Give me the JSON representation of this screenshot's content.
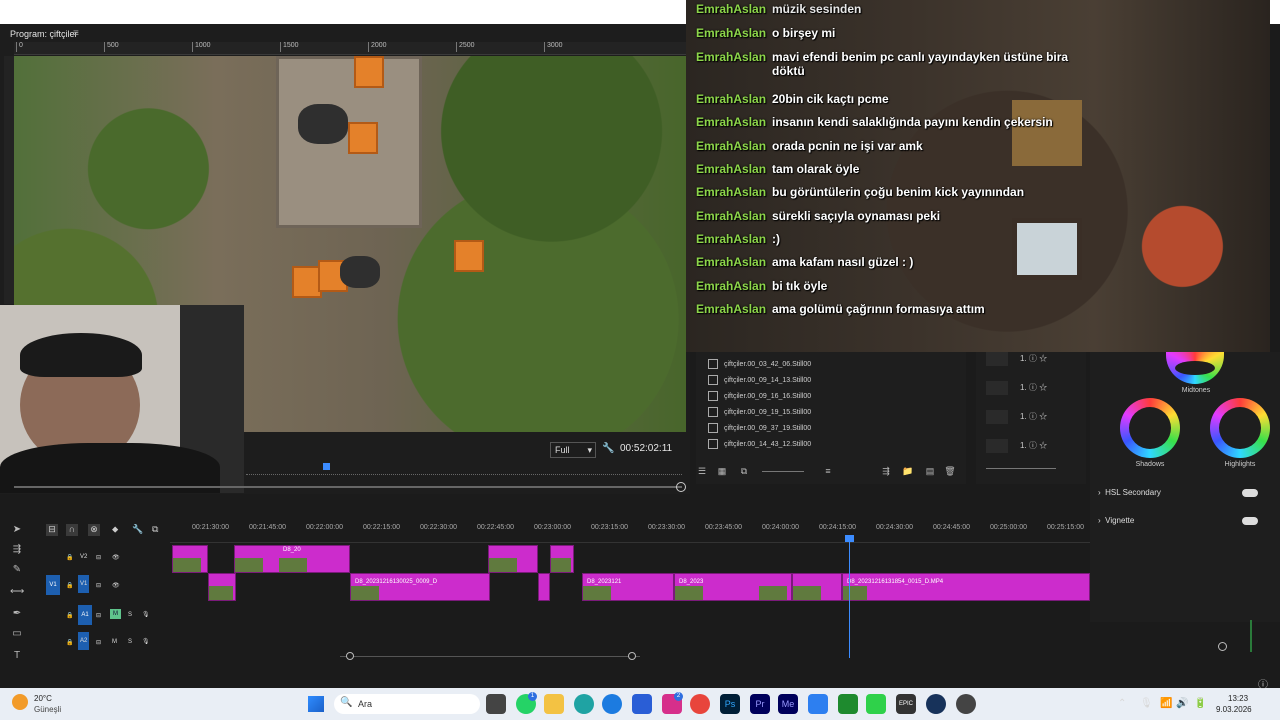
{
  "program_monitor": {
    "title": "Program: çiftçiler",
    "menu_icon": "hamburger-icon",
    "ruler_ticks": [
      "0",
      "500",
      "1000",
      "1500",
      "2000",
      "2500",
      "3000"
    ],
    "zoom_value": "Full",
    "timecode": "00:52:02:11"
  },
  "chat": {
    "header_user": "EmrahAslan",
    "header_msg": "müzik sesinden",
    "messages": [
      {
        "user": "EmrahAslan",
        "text": "o birşey mi"
      },
      {
        "user": "EmrahAslan",
        "text": "mavi efendi benim pc canlı yayındayken üstüne bira döktü"
      },
      {
        "user": "EmrahAslan",
        "text": "20bin cik kaçtı pcme"
      },
      {
        "user": "EmrahAslan",
        "text": "insanın kendi salaklığında payını kendin çekersin"
      },
      {
        "user": "EmrahAslan",
        "text": "orada pcnin ne işi var amk"
      },
      {
        "user": "EmrahAslan",
        "text": "tam olarak öyle"
      },
      {
        "user": "EmrahAslan",
        "text": "bu görüntülerin çoğu benim kick yayınından"
      },
      {
        "user": "EmrahAslan",
        "text": "sürekli saçıyla oynaması peki"
      },
      {
        "user": "EmrahAslan",
        "text": ":)"
      },
      {
        "user": "EmrahAslan",
        "text": "ama kafam nasıl güzel : )"
      },
      {
        "user": "EmrahAslan",
        "text": "bi tık öyle"
      },
      {
        "user": "EmrahAslan",
        "text": "ama golümü çağrının formasıya attım"
      }
    ]
  },
  "project_bin": {
    "items": [
      "çiftçiler.00_03_42_06.Still00",
      "çiftçiler.00_09_14_13.Still00",
      "çiftçiler.00_09_16_16.Still00",
      "çiftçiler.00_09_19_15.Still00",
      "çiftçiler.00_09_37_19.Still00",
      "çiftçiler.00_14_43_12.Still00"
    ]
  },
  "effects": {
    "rows": [
      "1.",
      "1.",
      "1.",
      "1."
    ]
  },
  "lumetri": {
    "midtones": "Midtones",
    "shadows": "Shadows",
    "highlights": "Highlights",
    "hsl": "HSL Secondary",
    "vignette": "Vignette"
  },
  "timeline": {
    "ruler": [
      "00:21:30:00",
      "00:21:45:00",
      "00:22:00:00",
      "00:22:15:00",
      "00:22:30:00",
      "00:22:45:00",
      "00:23:00:00",
      "00:23:15:00",
      "00:23:30:00",
      "00:23:45:00",
      "00:24:00:00",
      "00:24:15:00",
      "00:24:30:00",
      "00:24:45:00",
      "00:25:00:00",
      "00:25:15:00"
    ],
    "tracks": {
      "v2": "V2",
      "v1": "V1",
      "v1_src": "V1",
      "a1": "A1",
      "a1_src": "A1",
      "a2": "A2",
      "m": "M",
      "s": "S"
    },
    "clips": {
      "v2_b": "D8_20",
      "v1_a": "D8_20231216130025_0009_D",
      "v1_b": "D8_2023121",
      "v1_c": "D8_2023",
      "v1_d": "D8_20231216131854_0015_D.MP4"
    }
  },
  "taskbar": {
    "weather_temp": "20°C",
    "weather_desc": "Güneşli",
    "search_label": "Ara",
    "time": "13:23",
    "date": "9.03.2026",
    "whatsapp_badge": "1",
    "instagram_badge": "2"
  }
}
